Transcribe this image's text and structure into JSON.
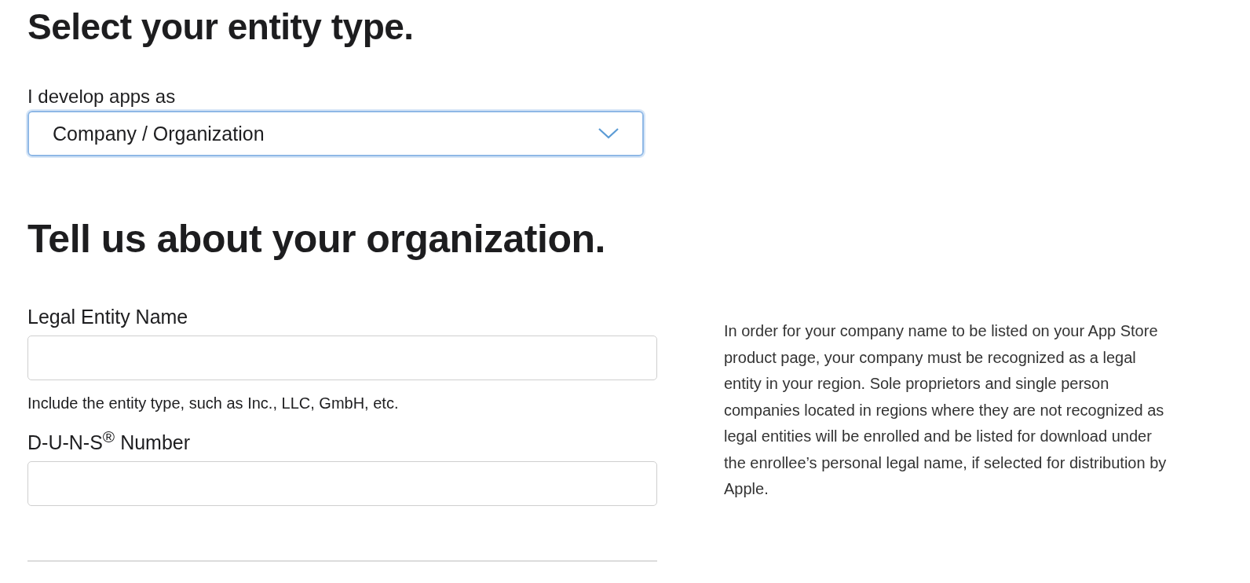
{
  "entity_section": {
    "title": "Select your entity type.",
    "select": {
      "label": "I develop apps as",
      "value": "Company / Organization",
      "focused": true
    }
  },
  "organization_section": {
    "title": "Tell us about your organization.",
    "fields": [
      {
        "label": "Legal Entity Name",
        "hint": "Include the entity type, such as Inc., LLC, GmbH, etc."
      },
      {
        "label": "D-U-N-S$^{®}$ Number"
      }
    ],
    "info": "In order for your company name to be listed on your App Store product page, your company must be recognized as a legal entity in your region. Sole proprietors and single person companies located in regions where they are not recognized as legal entities will be enrolled and be listed for download under the enrollee’s personal legal name, if selected for distribution by Apple."
  }
}
